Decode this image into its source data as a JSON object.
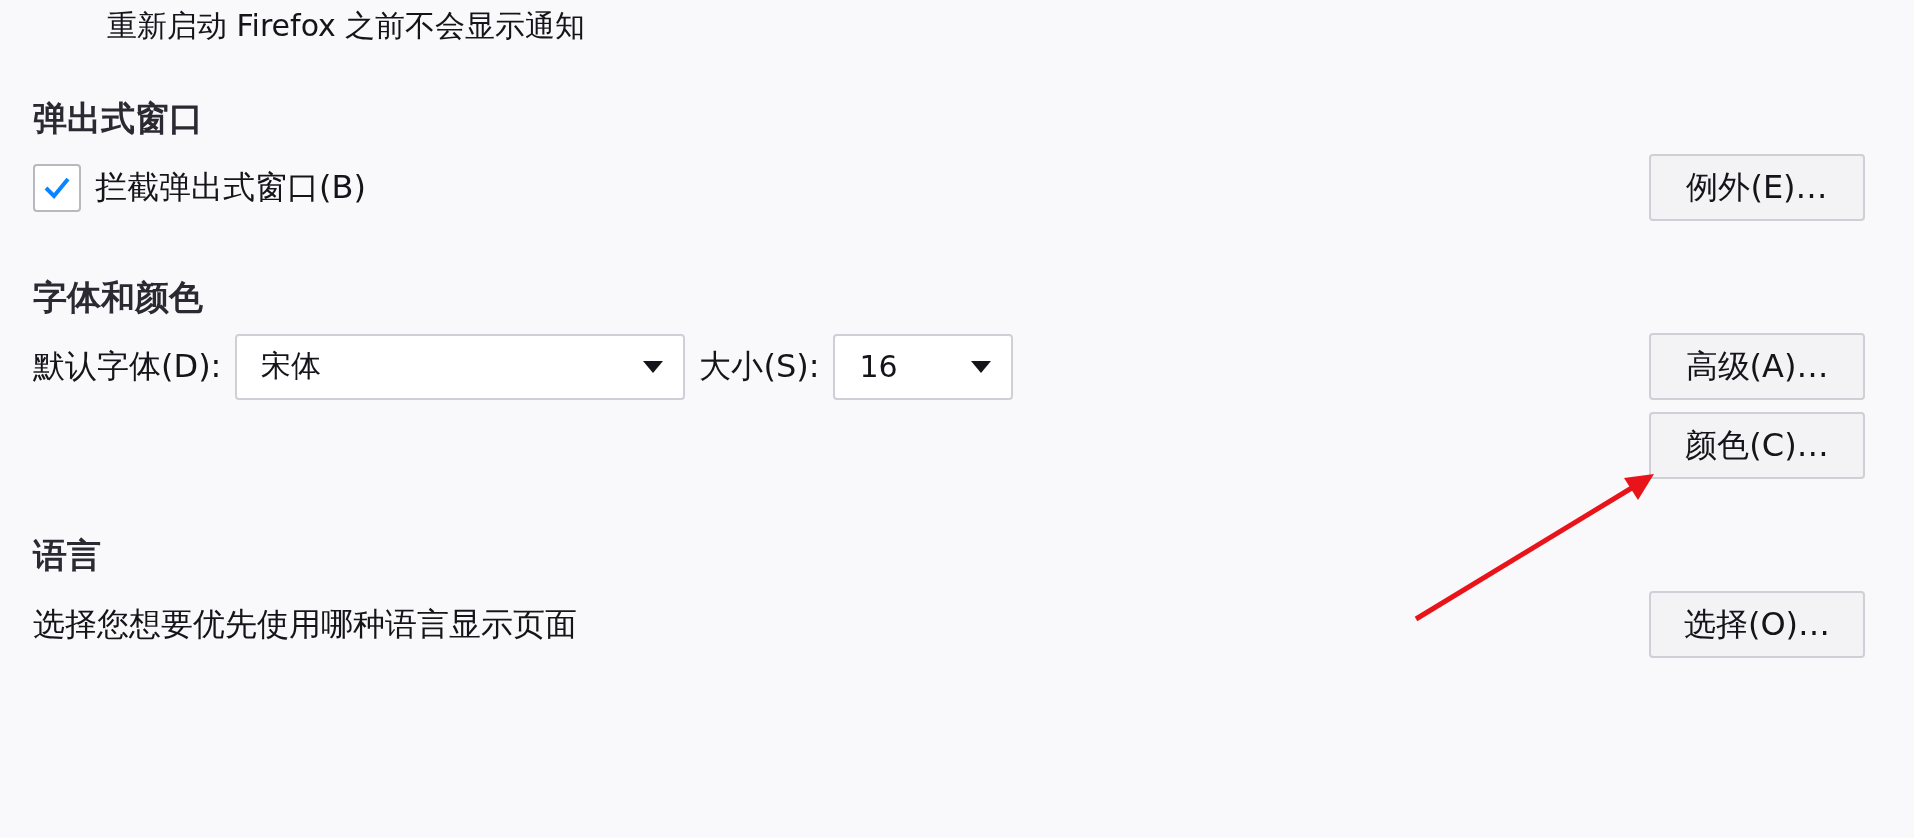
{
  "notice": "重新启动 Firefox 之前不会显示通知",
  "sections": [
    {
      "heading": "弹出式窗口",
      "rows": [
        {
          "kind": "checkbox",
          "label": "拦截弹出式窗口(B)",
          "checked": true,
          "button": "例外(E)…"
        }
      ]
    },
    {
      "heading": "字体和颜色",
      "rows": [
        {
          "kind": "fonts",
          "font_label": "默认字体(D):",
          "font_value": "宋体",
          "size_label": "大小(S):",
          "size_value": "16",
          "button": "高级(A)…"
        },
        {
          "kind": "button",
          "button": "颜色(C)…"
        }
      ]
    },
    {
      "heading": "语言",
      "rows": [
        {
          "kind": "text",
          "text": "选择您想要优先使用哪种语言显示页面",
          "button": "选择(O)…"
        }
      ]
    }
  ]
}
